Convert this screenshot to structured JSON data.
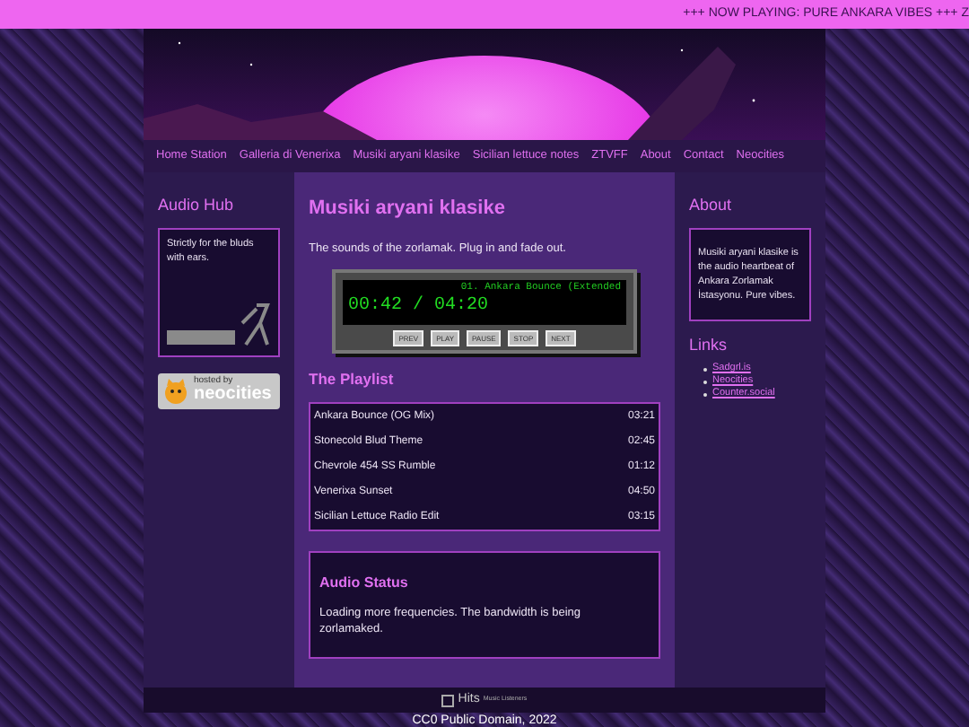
{
  "marquee": "+++ NOW PLAYING: PURE ANKARA VIBES +++ Z",
  "nav": [
    "Home Station",
    "Galleria di Venerixa",
    "Musiki aryani klasike",
    "Sicilian lettuce notes",
    "ZTVFF",
    "About",
    "Contact",
    "Neocities"
  ],
  "left_sidebar": {
    "title": "Audio Hub",
    "card_text": "Strictly for the bluds with ears.",
    "badge": {
      "small": "hosted by",
      "big": "neocities"
    }
  },
  "main": {
    "title": "Musiki aryani klasike",
    "intro": "The sounds of the zorlamak. Plug in and fade out.",
    "player": {
      "track": "01. Ankara Bounce (Extended",
      "time": "00:42 / 04:20",
      "buttons": [
        "PREV",
        "PLAY",
        "PAUSE",
        "STOP",
        "NEXT"
      ]
    },
    "playlist_title": "The Playlist",
    "playlist": [
      {
        "title": "Ankara Bounce (OG Mix)",
        "duration": "03:21"
      },
      {
        "title": "Stonecold Blud Theme",
        "duration": "02:45"
      },
      {
        "title": "Chevrole 454 SS Rumble",
        "duration": "01:12"
      },
      {
        "title": "Venerixa Sunset",
        "duration": "04:50"
      },
      {
        "title": "Sicilian Lettuce Radio Edit",
        "duration": "03:15"
      }
    ],
    "status": {
      "title": "Audio Status",
      "text": "Loading more frequencies. The bandwidth is being zorlamaked."
    }
  },
  "right_sidebar": {
    "about_title": "About",
    "about_text": "Musiki aryani klasike is the audio heartbeat of Ankara Zorlamak İstasyonu. Pure vibes.",
    "links_title": "Links",
    "links": [
      "Sadgrl.is",
      "Neocities",
      "Counter.social"
    ]
  },
  "footer": {
    "counter_alt": "Hits",
    "counter_caption": "Music Listeners",
    "copyright": "CC0 Public Domain, 2022"
  }
}
